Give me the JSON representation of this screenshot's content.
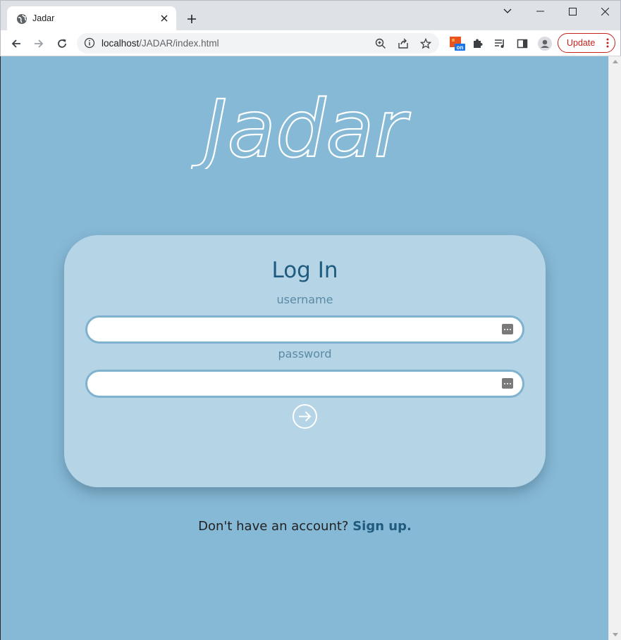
{
  "browser": {
    "tab_title": "Jadar",
    "url_host": "localhost",
    "url_path": "/JADAR/index.html",
    "update_label": "Update",
    "extension_badge": "on"
  },
  "page": {
    "logo_text": "Jadar",
    "form": {
      "title": "Log In",
      "username_label": "username",
      "username_value": "",
      "password_label": "password",
      "password_value": ""
    },
    "signup_prompt": "Don't have an account?",
    "signup_link": "Sign up."
  },
  "colors": {
    "page_bg": "#86b9d6",
    "card_bg": "#b5d5e7",
    "accent": "#1f5b7e"
  }
}
